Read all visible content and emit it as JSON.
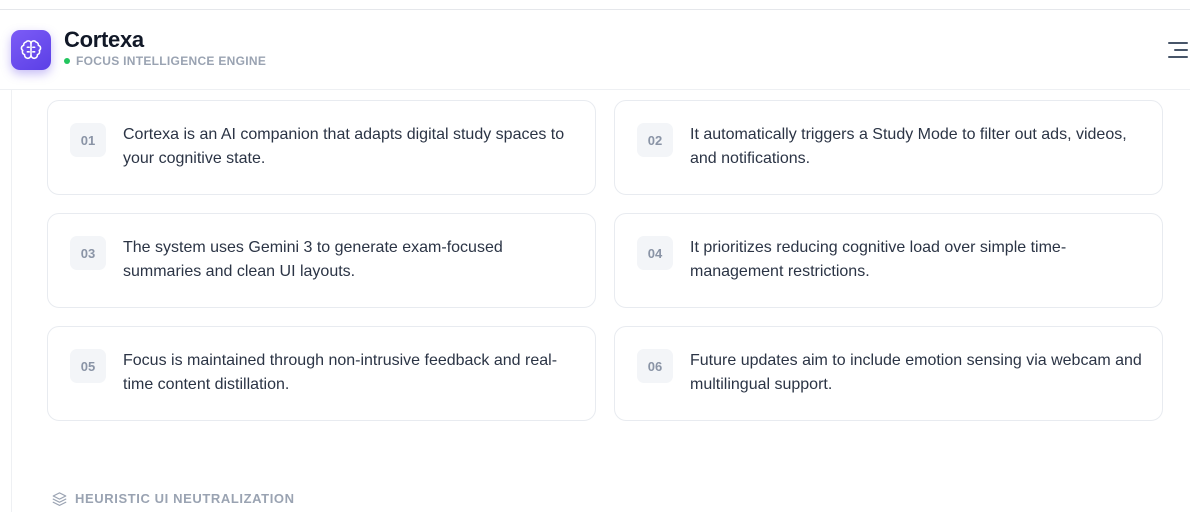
{
  "header": {
    "app_name": "Cortexa",
    "tagline": "FOCUS INTELLIGENCE ENGINE",
    "status_color": "#22c55e",
    "logo_icon": "brain-icon",
    "menu_icon": "menu-icon",
    "accent": "#6d4aef"
  },
  "cards": [
    {
      "number": "01",
      "text": "Cortexa is an AI companion that adapts digital study spaces to your cognitive state."
    },
    {
      "number": "02",
      "text": "It automatically triggers a Study Mode to filter out ads, videos, and notifications."
    },
    {
      "number": "03",
      "text": "The system uses Gemini 3 to generate exam-focused summaries and clean UI layouts."
    },
    {
      "number": "04",
      "text": "It prioritizes reducing cognitive load over simple time-management restrictions."
    },
    {
      "number": "05",
      "text": "Focus is maintained through non-intrusive feedback and real-time content distillation."
    },
    {
      "number": "06",
      "text": "Future updates aim to include emotion sensing via webcam and multilingual support."
    }
  ],
  "section": {
    "label": "HEURISTIC UI NEUTRALIZATION",
    "icon": "layers-icon"
  }
}
